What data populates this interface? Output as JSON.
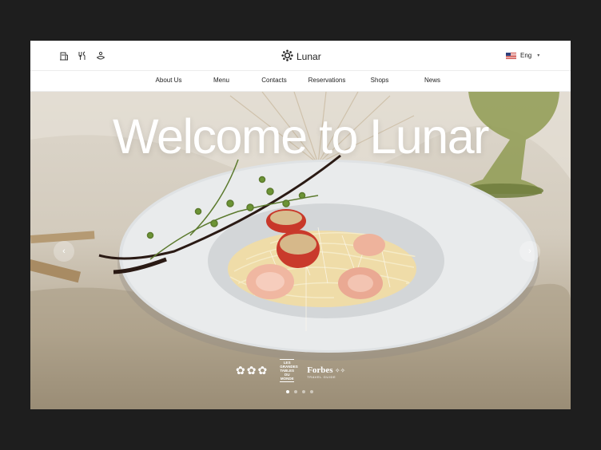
{
  "brand": {
    "name": "Lunar",
    "logo_icon": "sun-gear-icon"
  },
  "top_icons": [
    {
      "name": "hotel-icon"
    },
    {
      "name": "restaurant-icon"
    },
    {
      "name": "spa-icon"
    }
  ],
  "language": {
    "label": "Eng",
    "flag_icon": "us-flag-icon"
  },
  "nav": [
    "About Us",
    "Menu",
    "Contacts",
    "Reservations",
    "Shops",
    "News"
  ],
  "hero": {
    "title": "Welcome to Lunar",
    "prev_icon": "chevron-left-icon",
    "next_icon": "chevron-right-icon",
    "awards": {
      "michelin_stars": 3,
      "tables_text": [
        "LES",
        "GRANDES",
        "TABLES",
        "DU",
        "MONDE"
      ],
      "forbes_name": "Forbes",
      "forbes_sub": "TRAVEL GUIDE"
    },
    "slides": {
      "count": 4,
      "active": 1
    }
  },
  "colors": {
    "accent": "#ffffff",
    "nav_text": "#222222",
    "background": "#1e1e1e"
  }
}
